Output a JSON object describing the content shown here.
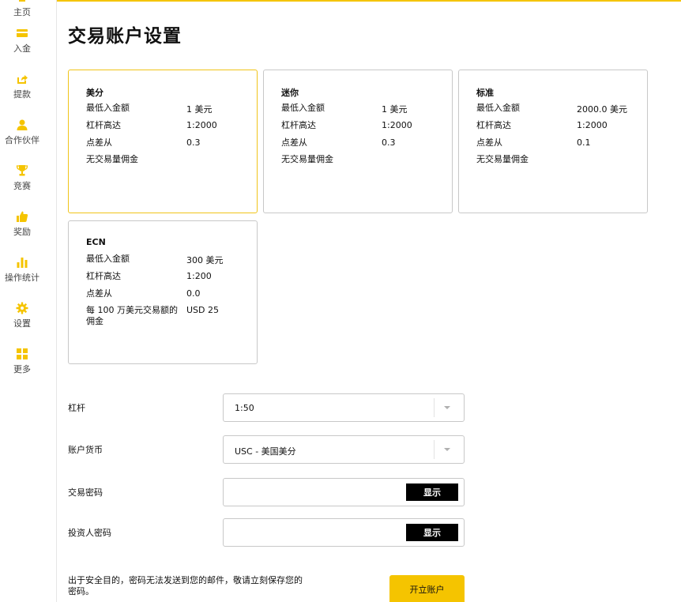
{
  "sidebar": {
    "items": [
      {
        "label": "主页",
        "icon": "home-icon"
      },
      {
        "label": "入金",
        "icon": "credit-card-icon"
      },
      {
        "label": "提款",
        "icon": "share-out-icon"
      },
      {
        "label": "合作伙伴",
        "icon": "user-icon"
      },
      {
        "label": "竞赛",
        "icon": "trophy-icon"
      },
      {
        "label": "奖励",
        "icon": "thumbs-up-icon"
      },
      {
        "label": "操作统计",
        "icon": "bar-chart-icon"
      },
      {
        "label": "设置",
        "icon": "gear-icon"
      },
      {
        "label": "更多",
        "icon": "grid-icon"
      }
    ],
    "accent_color": "#f5c400"
  },
  "page": {
    "title": "交易账户设置"
  },
  "cards": [
    {
      "title": "美分",
      "selected": true,
      "rows": [
        {
          "label": "最低入金额",
          "value": "1 美元"
        },
        {
          "label": "杠杆高达",
          "value": "1:2000"
        },
        {
          "label": "点差从",
          "value": "0.3"
        },
        {
          "label": "无交易量佣金",
          "value": ""
        }
      ]
    },
    {
      "title": "迷你",
      "selected": false,
      "rows": [
        {
          "label": "最低入金额",
          "value": "1 美元"
        },
        {
          "label": "杠杆高达",
          "value": "1:2000"
        },
        {
          "label": "点差从",
          "value": "0.3"
        },
        {
          "label": "无交易量佣金",
          "value": ""
        }
      ]
    },
    {
      "title": "标准",
      "selected": false,
      "rows": [
        {
          "label": "最低入金额",
          "value": "2000.0 美元"
        },
        {
          "label": "杠杆高达",
          "value": "1:2000"
        },
        {
          "label": "点差从",
          "value": "0.1"
        },
        {
          "label": "无交易量佣金",
          "value": ""
        }
      ]
    },
    {
      "title": "ECN",
      "selected": false,
      "rows": [
        {
          "label": "最低入金额",
          "value": "300 美元"
        },
        {
          "label": "杠杆高达",
          "value": "1:200"
        },
        {
          "label": "点差从",
          "value": "0.0"
        },
        {
          "label": "每 100 万美元交易额的佣金",
          "value": "USD 25"
        }
      ]
    }
  ],
  "form": {
    "leverage": {
      "label": "杠杆",
      "value": "1:50"
    },
    "currency": {
      "label": "账户货币",
      "value": "USC - 美国美分"
    },
    "trade_password": {
      "label": "交易密码",
      "show_label": "显示"
    },
    "investor_password": {
      "label": "投资人密码",
      "show_label": "显示"
    }
  },
  "footer": {
    "notice": "出于安全目的，密码无法发送到您的邮件，敬请立刻保存您的密码。",
    "open_button": "开立账户"
  }
}
